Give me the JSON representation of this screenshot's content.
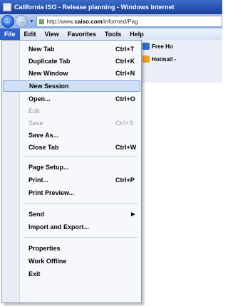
{
  "window": {
    "title": "California ISO - Release planning - Windows Internet"
  },
  "address": {
    "url_prefix": "http://www.",
    "url_domain": "caiso.com",
    "url_rest": "/informed/Pag"
  },
  "menubar": {
    "items": [
      "File",
      "Edit",
      "View",
      "Favorites",
      "Tools",
      "Help"
    ]
  },
  "toolbar": {
    "free_label": "Free Ho",
    "hotmail_label": "Hotmail -"
  },
  "file_menu": {
    "new_tab": {
      "label": "New Tab",
      "shortcut": "Ctrl+T"
    },
    "duplicate_tab": {
      "label": "Duplicate Tab",
      "shortcut": "Ctrl+K"
    },
    "new_window": {
      "label": "New Window",
      "shortcut": "Ctrl+N"
    },
    "new_session": {
      "label": "New Session"
    },
    "open": {
      "label": "Open...",
      "shortcut": "Ctrl+O"
    },
    "edit": {
      "label": "Edit"
    },
    "save": {
      "label": "Save",
      "shortcut": "Ctrl+S"
    },
    "save_as": {
      "label": "Save As..."
    },
    "close_tab": {
      "label": "Close Tab",
      "shortcut": "Ctrl+W"
    },
    "page_setup": {
      "label": "Page Setup..."
    },
    "print": {
      "label": "Print...",
      "shortcut": "Ctrl+P"
    },
    "print_preview": {
      "label": "Print Preview..."
    },
    "send": {
      "label": "Send"
    },
    "import_export": {
      "label": "Import and Export..."
    },
    "properties": {
      "label": "Properties"
    },
    "work_offline": {
      "label": "Work Offline"
    },
    "exit": {
      "label": "Exit"
    }
  },
  "colors": {
    "titlebar": "#1a3f9a",
    "menu_highlight": "#cfe0f7",
    "active_menu": "#2f62c9"
  }
}
